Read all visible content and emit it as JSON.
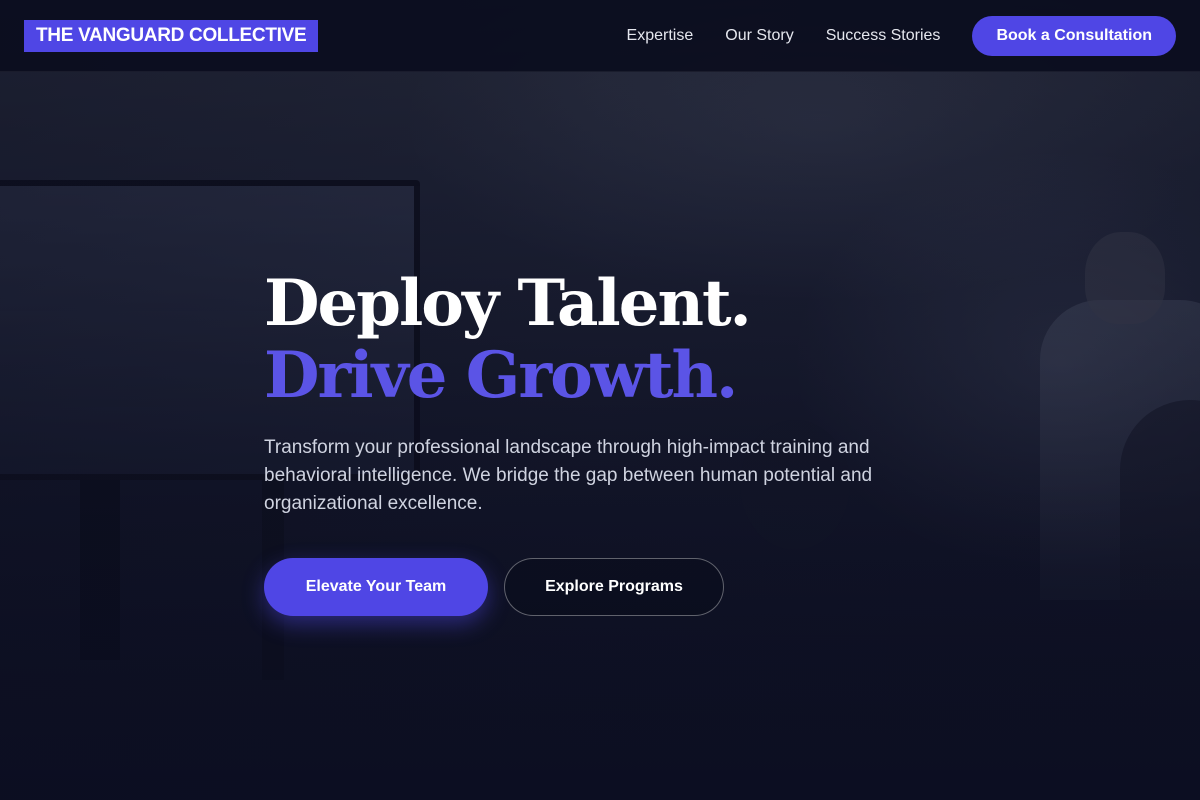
{
  "header": {
    "logo": "THE VANGUARD COLLECTIVE",
    "nav": [
      {
        "label": "Expertise"
      },
      {
        "label": "Our Story"
      },
      {
        "label": "Success Stories"
      }
    ],
    "cta_label": "Book a Consultation"
  },
  "hero": {
    "headline_line1": "Deploy Talent.",
    "headline_line2": "Drive Growth.",
    "lead": "Transform your professional landscape through high-impact training and behavioral intelligence. We bridge the gap between human potential and organizational excellence.",
    "primary_button": "Elevate Your Team",
    "secondary_button": "Explore Programs"
  },
  "colors": {
    "accent": "#4f46e5",
    "headline_accent": "#5b54e6",
    "background": "#0d1024"
  }
}
